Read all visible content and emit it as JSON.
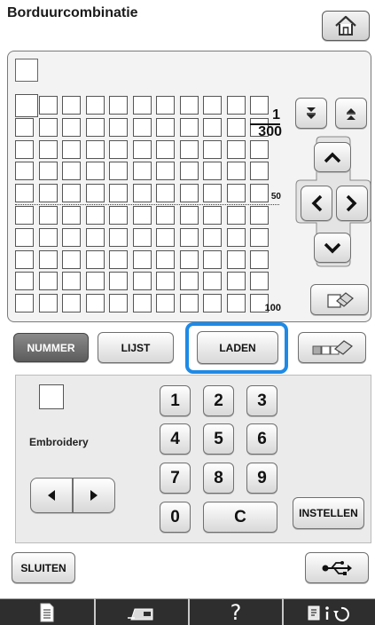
{
  "header": {
    "title": "Borduurcombinatie",
    "home_icon": "home-icon"
  },
  "grid": {
    "rows": 10,
    "cols": 11,
    "page_current": "1",
    "page_total": "300",
    "marker_50": "50",
    "marker_100": "100"
  },
  "controls": {
    "nummer_label": "NUMMER",
    "lijst_label": "LIJST",
    "laden_label": "LADEN",
    "highlight_color": "#1e8ae6"
  },
  "keypad": {
    "keys": [
      "1",
      "2",
      "3",
      "4",
      "5",
      "6",
      "7",
      "8",
      "9",
      "0"
    ],
    "clear_label": "C",
    "set_label": "INSTELLEN"
  },
  "preview": {
    "label": "Embroidery"
  },
  "footer": {
    "close_label": "SLUITEN",
    "usb_icon": "usb-icon"
  },
  "taskbar": {
    "help_label": "?"
  }
}
